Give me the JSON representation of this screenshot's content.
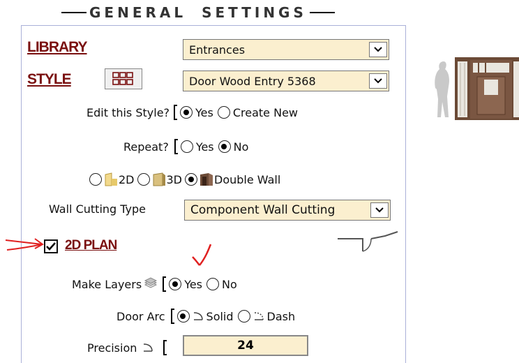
{
  "heading": {
    "title": "GENERAL SETTINGS"
  },
  "library": {
    "label": "LIBRARY",
    "selected": "Entrances"
  },
  "style": {
    "label": "STYLE",
    "selected": "Door Wood Entry 5368"
  },
  "edit_style": {
    "label": "Edit this Style?",
    "opt_yes": "Yes",
    "opt_new": "Create New",
    "selected": "Yes"
  },
  "repeat": {
    "label": "Repeat?",
    "opt_yes": "Yes",
    "opt_no": "No",
    "selected": "No"
  },
  "view_mode": {
    "opt_2d": "2D",
    "opt_3d": "3D",
    "opt_double": "Double Wall",
    "selected": "Double Wall"
  },
  "wall_cutting": {
    "label": "Wall Cutting Type",
    "selected": "Component Wall Cutting"
  },
  "plan2d": {
    "label": "2D PLAN",
    "checked": true
  },
  "make_layers": {
    "label": "Make Layers",
    "opt_yes": "Yes",
    "opt_no": "No",
    "selected": "Yes"
  },
  "door_arc": {
    "label": "Door Arc",
    "opt_solid": "Solid",
    "opt_dash": "Dash",
    "selected": "Solid"
  },
  "precision": {
    "label": "Precision",
    "value": "24"
  },
  "colors": {
    "link": "#7a1010",
    "field_bg": "#fbefcf",
    "annotation": "#e02020",
    "panel_border": "#aab0d8"
  }
}
